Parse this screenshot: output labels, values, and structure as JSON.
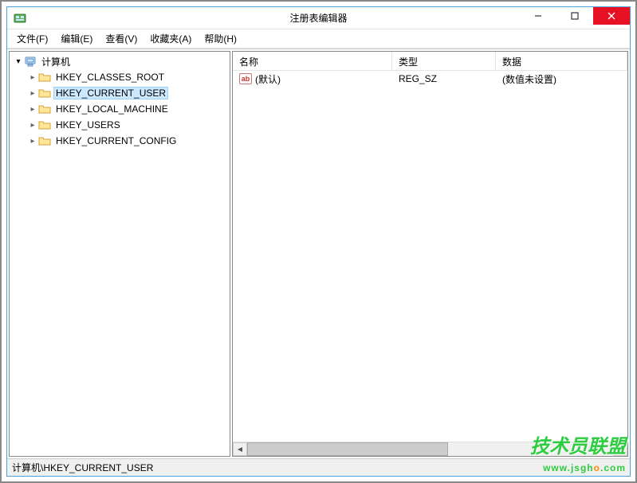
{
  "window": {
    "title": "注册表编辑器"
  },
  "menubar": {
    "file": "文件(F)",
    "edit": "编辑(E)",
    "view": "查看(V)",
    "favorites": "收藏夹(A)",
    "help": "帮助(H)"
  },
  "tree": {
    "root": "计算机",
    "items": [
      {
        "label": "HKEY_CLASSES_ROOT",
        "selected": false
      },
      {
        "label": "HKEY_CURRENT_USER",
        "selected": true
      },
      {
        "label": "HKEY_LOCAL_MACHINE",
        "selected": false
      },
      {
        "label": "HKEY_USERS",
        "selected": false
      },
      {
        "label": "HKEY_CURRENT_CONFIG",
        "selected": false
      }
    ]
  },
  "list": {
    "headers": {
      "name": "名称",
      "type": "类型",
      "data": "数据"
    },
    "rows": [
      {
        "name": "(默认)",
        "type": "REG_SZ",
        "data": "(数值未设置)"
      }
    ],
    "string_icon_label": "ab"
  },
  "statusbar": {
    "path": "计算机\\HKEY_CURRENT_USER"
  },
  "watermark": {
    "line1": "技术员联盟",
    "line2_pre": "www.jsgh",
    "line2_dot": "o",
    "line2_suf": ".com"
  }
}
